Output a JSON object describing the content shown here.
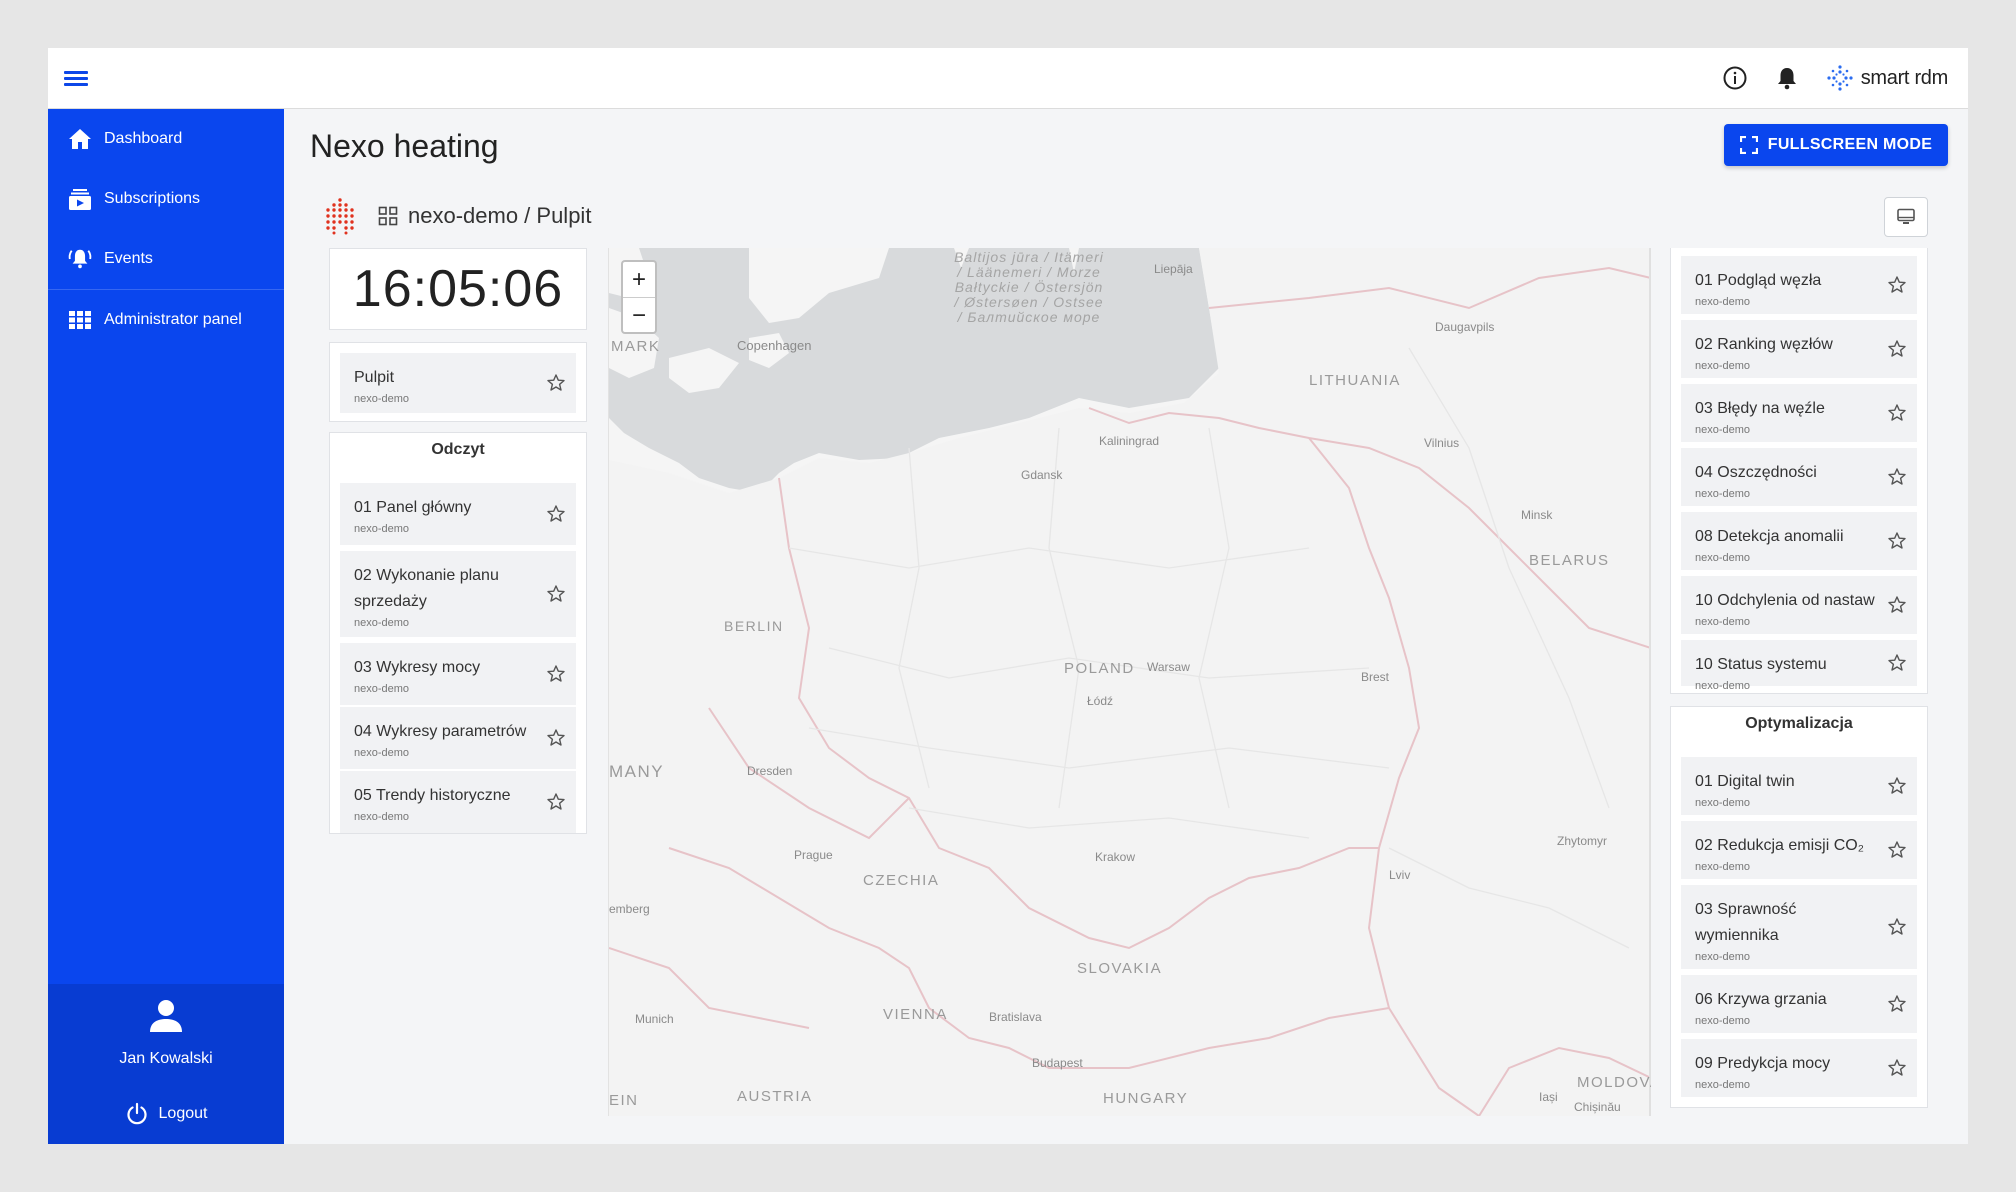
{
  "brand": {
    "name": "smart rdm"
  },
  "sidebar": {
    "items": [
      {
        "label": "Dashboard",
        "icon": "home-icon"
      },
      {
        "label": "Subscriptions",
        "icon": "subscriptions-icon"
      },
      {
        "label": "Events",
        "icon": "bell-ring-icon"
      },
      {
        "label": "Administrator panel",
        "icon": "grid-icon"
      }
    ],
    "user": {
      "name": "Jan Kowalski"
    },
    "logout_label": "Logout"
  },
  "page": {
    "title": "Nexo heating",
    "fullscreen_label": "FULLSCREEN MODE",
    "breadcrumb": "nexo-demo / Pulpit"
  },
  "clock": {
    "time": "16:05:06"
  },
  "left": {
    "pulpit": {
      "title": "Pulpit",
      "sub": "nexo-demo"
    },
    "odczyt": {
      "title": "Odczyt",
      "items": [
        {
          "title": "01 Panel główny",
          "sub": "nexo-demo"
        },
        {
          "title": "02 Wykonanie planu sprzedaży",
          "sub": "nexo-demo"
        },
        {
          "title": "03 Wykresy mocy",
          "sub": "nexo-demo"
        },
        {
          "title": "04 Wykresy parametrów",
          "sub": "nexo-demo"
        },
        {
          "title": "05 Trendy historyczne",
          "sub": "nexo-demo"
        }
      ]
    }
  },
  "right": {
    "analiza": {
      "items": [
        {
          "title": "01 Podgląd węzła",
          "sub": "nexo-demo"
        },
        {
          "title": "02 Ranking węzłów",
          "sub": "nexo-demo"
        },
        {
          "title": "03 Błędy na węźle",
          "sub": "nexo-demo"
        },
        {
          "title": "04 Oszczędności",
          "sub": "nexo-demo"
        },
        {
          "title": "08 Detekcja anomalii",
          "sub": "nexo-demo"
        },
        {
          "title": "10 Odchylenia od nastaw",
          "sub": "nexo-demo"
        },
        {
          "title": "10 Status systemu",
          "sub": "nexo-demo"
        }
      ]
    },
    "optymalizacja": {
      "title": "Optymalizacja",
      "items": [
        {
          "title": "01 Digital twin",
          "sub": "nexo-demo"
        },
        {
          "title": "02 Redukcja emisji CO₂",
          "sub": "nexo-demo"
        },
        {
          "title": "03 Sprawność wymiennika",
          "sub": "nexo-demo"
        },
        {
          "title": "06 Krzywa grzania",
          "sub": "nexo-demo"
        },
        {
          "title": "09 Predykcja mocy",
          "sub": "nexo-demo"
        }
      ]
    }
  },
  "map": {
    "zoom_in": "+",
    "zoom_out": "−",
    "sea_label": "Baltijos jūra / Itämeri / Läänemeri / Morze Bałtyckie / Östersjön / Østersøen / Ostsee / Балтийское море",
    "labels": {
      "copenhagen": "Copenhagen",
      "mark": "MARK",
      "liepaja": "Liepāja",
      "daugavpils": "Daugavpils",
      "lithuania": "LITHUANIA",
      "kaliningrad": "Kaliningrad",
      "gdansk": "Gdansk",
      "vilnius": "Vilnius",
      "minsk": "Minsk",
      "belarus": "BELARUS",
      "berlin": "BERLIN",
      "poland": "POLAND",
      "warsaw": "Warsaw",
      "brest": "Brest",
      "lodz": "Łódź",
      "many": "MANY",
      "dresden": "Dresden",
      "prague": "Prague",
      "czechia": "CZECHIA",
      "krakow": "Krakow",
      "zhytomyr": "Zhytomyr",
      "lviv": "Lviv",
      "emberg": "emberg",
      "slovakia": "SLOVAKIA",
      "munich": "Munich",
      "vienna": "VIENNA",
      "bratislava": "Bratislava",
      "budapest": "Budapest",
      "ein": "EIN",
      "austria": "AUSTRIA",
      "hungary": "HUNGARY",
      "iasi": "Iași",
      "moldova": "MOLDOVA",
      "chisinau": "Chișinău"
    }
  }
}
